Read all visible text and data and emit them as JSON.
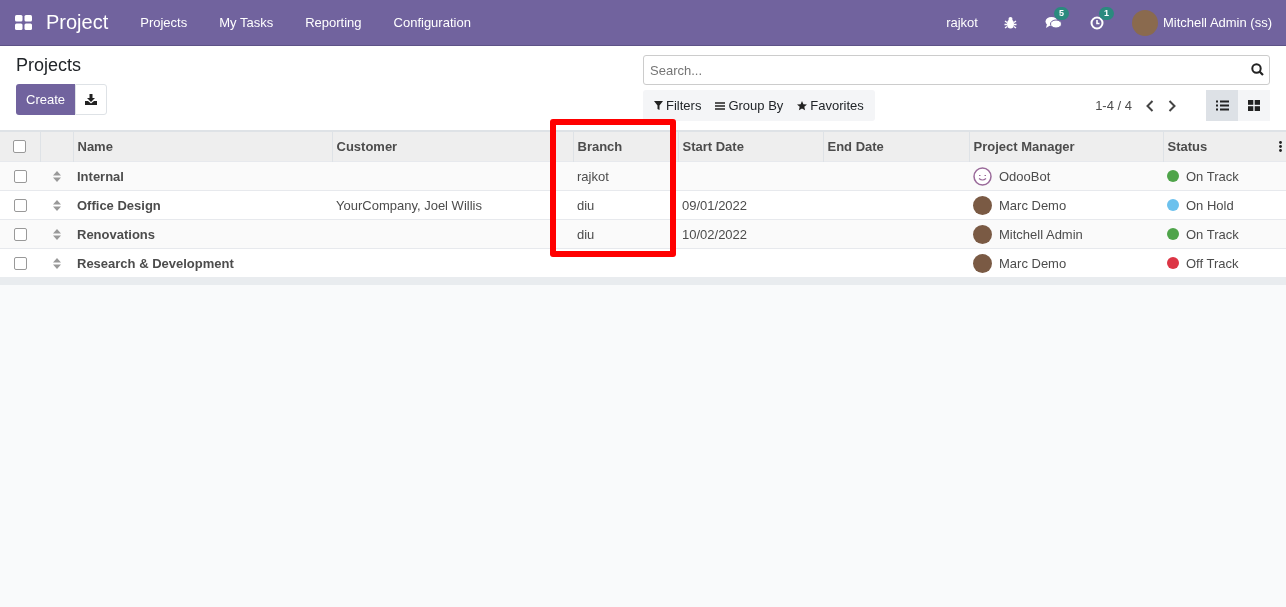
{
  "navbar": {
    "app_title": "Project",
    "menu": [
      "Projects",
      "My Tasks",
      "Reporting",
      "Configuration"
    ],
    "company": "rajkot",
    "messages_badge": "5",
    "activities_badge": "1",
    "user": "Mitchell Admin (ss)"
  },
  "control_panel": {
    "title": "Projects",
    "create_button": "Create",
    "search": {
      "placeholder": "Search..."
    },
    "filters": [
      "Filters",
      "Group By",
      "Favorites"
    ],
    "pager": "1-4 / 4",
    "views": [
      {
        "kind": "list",
        "selected": true
      },
      {
        "kind": "kanban",
        "selected": false
      }
    ]
  },
  "table": {
    "select_all_checked": false,
    "columns": [
      "Name",
      "Customer",
      "Branch",
      "Start Date",
      "End Date",
      "Project Manager",
      "Status"
    ],
    "rows": [
      {
        "checked": false,
        "name": "Internal",
        "customer": "",
        "branch": "rajkot",
        "start_date": "",
        "end_date": "",
        "manager": {
          "kind": "bot",
          "name": "OdooBot"
        },
        "status": "On Track",
        "color": "#4fa44a"
      },
      {
        "checked": false,
        "name": "Office Design",
        "customer": "YourCompany, Joel Willis",
        "branch": "diu",
        "start_date": "09/01/2022",
        "end_date": "",
        "manager": {
          "kind": "person",
          "name": "Marc Demo"
        },
        "status": "On Hold",
        "color": "#6cc1ed"
      },
      {
        "checked": false,
        "name": "Renovations",
        "customer": "",
        "branch": "diu",
        "start_date": "10/02/2022",
        "end_date": "",
        "manager": {
          "kind": "person",
          "name": "Mitchell Admin"
        },
        "status": "On Track",
        "color": "#4fa44a"
      },
      {
        "checked": false,
        "name": "Research & Development",
        "customer": "",
        "branch": "",
        "start_date": "",
        "end_date": "",
        "manager": {
          "kind": "person",
          "name": "Marc Demo"
        },
        "status": "Off Track",
        "color": "#dc3545"
      }
    ]
  }
}
